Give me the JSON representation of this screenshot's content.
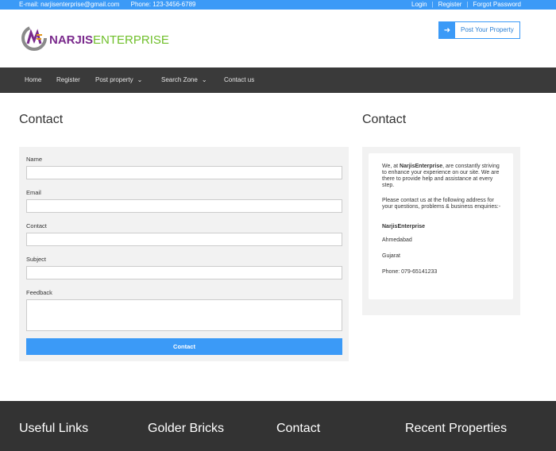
{
  "topbar": {
    "email": "E-mail: narjisenterprise@gmail.com",
    "phone": "Phone: 123-3456-6789",
    "login": "Login",
    "register": "Register",
    "forgot": "Forgot Password"
  },
  "header": {
    "logo_part1": "NARJIS",
    "logo_part2": "ENTERPRISE",
    "post_property": "Post Your Property"
  },
  "nav": {
    "items": [
      "Home",
      "Register",
      "Post property",
      "Search Zone",
      "Contact us"
    ]
  },
  "main": {
    "left_title": "Contact",
    "right_title": "Contact",
    "form": {
      "name_label": "Name",
      "email_label": "Email",
      "contact_label": "Contact",
      "subject_label": "Subject",
      "feedback_label": "Feedback",
      "submit_label": "Contact"
    },
    "info": {
      "intro_prefix": "We, at ",
      "intro_brand": "NarjisEnterprise",
      "intro_suffix": ", are constantly striving to enhance your experience on our site. We are there to provide help and assistance at every step.",
      "contact_line": "Please contact us at the following address for your questions, problems & business enquiries:-",
      "company": "NarjisEnterprise",
      "city": "Ahmedabad",
      "state": "Gujarat",
      "phone": "Phone: 079-65141233"
    }
  },
  "footer": {
    "useful_links": "Useful Links",
    "golder_bricks": "Golder Bricks",
    "contact": "Contact",
    "recent": "Recent Properties"
  },
  "colors": {
    "accent": "#3b9af7",
    "nav_bg": "#3a3a3a",
    "footer_bg": "#333333",
    "logo_purple": "#7a2a8c",
    "logo_green": "#6fbf2a"
  }
}
